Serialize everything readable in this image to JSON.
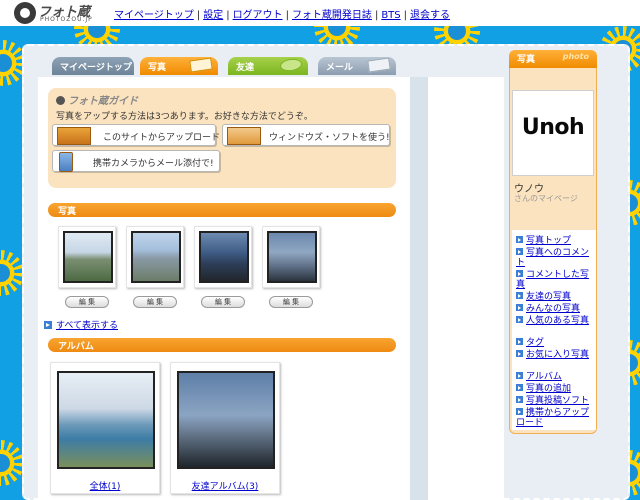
{
  "header": {
    "logo_text": "フォト蔵",
    "logo_sub": "PHOTOZOU.JP",
    "links": [
      "マイページトップ",
      "設定",
      "ログアウト",
      "フォト蔵開発日誌",
      "BTS",
      "退会する"
    ]
  },
  "tabs": {
    "mypage": "マイページトップ",
    "photo": "写真",
    "friend": "友達",
    "mail": "メール"
  },
  "guide": {
    "title": "フォト蔵ガイド",
    "text": "写真をアップする方法は3つあります。お好きな方法でどうぞ。",
    "btn_site": "このサイトからアップロード",
    "btn_windows": "ウィンドウズ・ソフトを使う!",
    "btn_mobile": "携帯カメラからメール添付で!"
  },
  "photos": {
    "section_title": "写真",
    "edit_label": "編 集",
    "show_all": "すべて表示する"
  },
  "albums": {
    "section_title": "アルバム",
    "items": [
      "全体(1)",
      "友達アルバム(3)"
    ]
  },
  "sidebar": {
    "title": "写真",
    "title_en": "photo",
    "avatar_text": "Unoh",
    "user_name": "ウノウ",
    "user_sub": "さんのマイページ",
    "links": [
      "写真トップ",
      "写真へのコメント",
      "コメントした写真",
      "友達の写真",
      "みんなの写真",
      "人気のある写真",
      "タグ",
      "お気に入り写真",
      "アルバム",
      "写真の追加",
      "写真投稿ソフト",
      "携帯からアップロード"
    ]
  },
  "colors": {
    "background_blue": "#12a0e4",
    "accent_orange": "#f08a00",
    "guide_beige": "#fbe3bf",
    "link_blue": "#0000cc"
  }
}
